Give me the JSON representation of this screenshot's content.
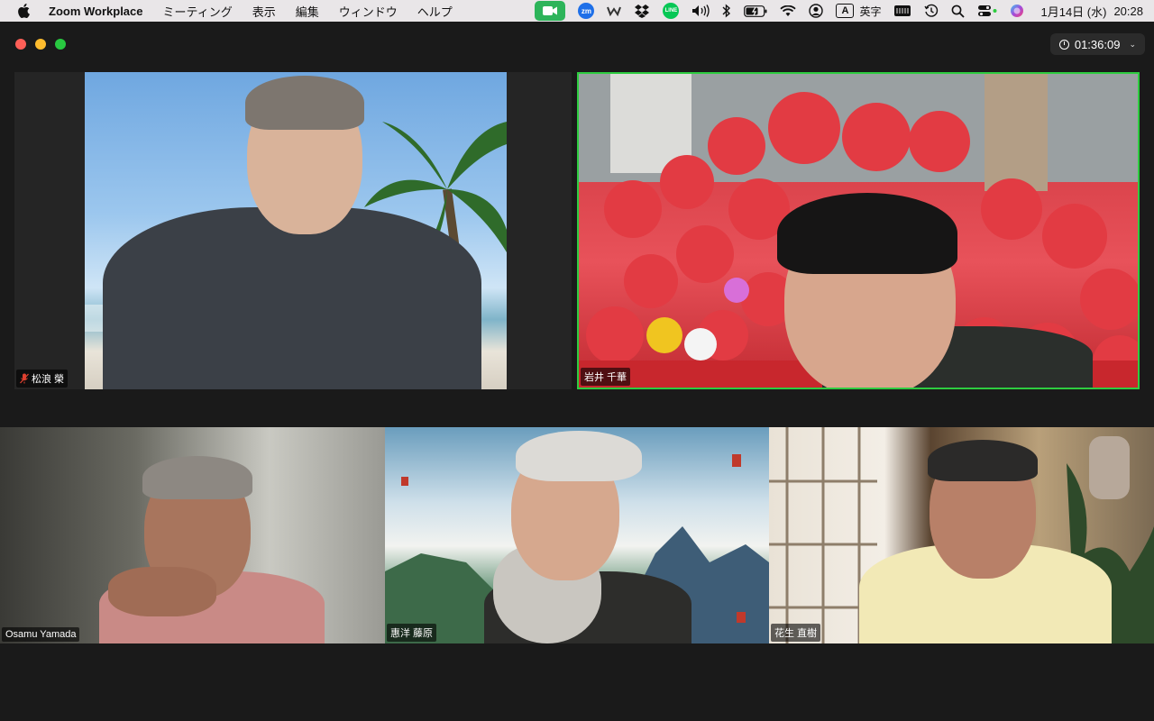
{
  "menubar": {
    "app_name": "Zoom Workplace",
    "menus": [
      "ミーティング",
      "表示",
      "編集",
      "ウィンドウ",
      "ヘルプ"
    ],
    "status": {
      "zm_label": "zm",
      "line_label": "LINE",
      "input_letter": "A",
      "input_label": "英字",
      "date": "1月14日 (水)",
      "time": "20:28"
    }
  },
  "meeting": {
    "elapsed": "01:36:09",
    "participants": [
      {
        "name": "松浪 榮",
        "muted": true,
        "active_speaker": false
      },
      {
        "name": "岩井 千華",
        "muted": false,
        "active_speaker": true
      },
      {
        "name": "Osamu Yamada",
        "muted": false,
        "active_speaker": false
      },
      {
        "name": "惠洋 藤原",
        "muted": false,
        "active_speaker": false
      },
      {
        "name": "花生 直樹",
        "muted": false,
        "active_speaker": false
      }
    ]
  },
  "colors": {
    "active_speaker_border": "#2ecc40",
    "muted_icon": "#e0402f",
    "zoom_status_green": "#2db45a"
  }
}
